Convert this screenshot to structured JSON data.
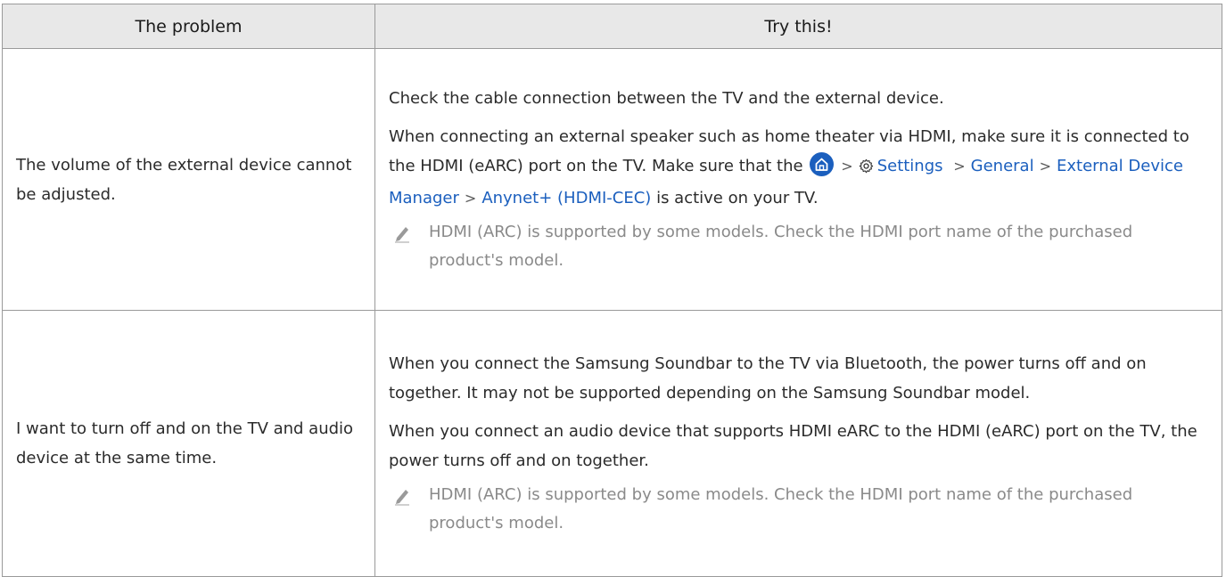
{
  "header": {
    "col_problem": "The problem",
    "col_try": "Try this!"
  },
  "rows": [
    {
      "problem": "The volume of the external device cannot be adjusted.",
      "p1": "Check the cable connection between the TV and the external device.",
      "p2_a": "When connecting an external speaker such as home theater via HDMI, make sure it is connected to the HDMI (eARC) port on the TV. Make sure that the",
      "menu_settings": "Settings",
      "menu_general": "General",
      "menu_edm": "External Device Manager",
      "menu_anynet": "Anynet+ (HDMI-CEC)",
      "p2_b": "is active on your TV.",
      "note": "HDMI (ARC) is supported by some models. Check the HDMI port name of the purchased product's model."
    },
    {
      "problem": "I want to turn off and on the TV and audio device at the same time.",
      "p1": "When you connect the Samsung Soundbar to the TV via Bluetooth, the power turns off and on together. It may not be supported depending on the Samsung Soundbar model.",
      "p2": "When you connect an audio device that supports HDMI eARC to the HDMI (eARC) port on the TV, the power turns off and on together.",
      "note": "HDMI (ARC) is supported by some models. Check the HDMI port name of the purchased product's model."
    }
  ],
  "icons": {
    "home": "home-icon",
    "settings": "gear-icon",
    "note": "pencil-icon",
    "separator": "chevron-right-icon"
  },
  "colors": {
    "link": "#1b5fbe",
    "header_bg": "#e8e8e8",
    "note_text": "#8a8a8a"
  }
}
